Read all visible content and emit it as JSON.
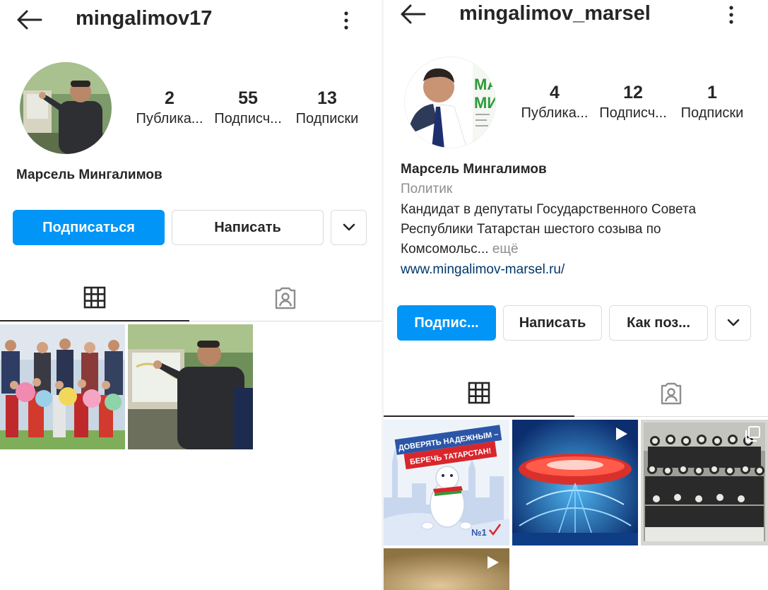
{
  "left": {
    "username": "mingalimov17",
    "stats": [
      {
        "num": "2",
        "label": "Публика..."
      },
      {
        "num": "55",
        "label": "Подписч..."
      },
      {
        "num": "13",
        "label": "Подписки"
      }
    ],
    "full_name": "Марсель Мингалимов",
    "buttons": {
      "follow": "Подписаться",
      "message": "Написать"
    }
  },
  "right": {
    "username": "mingalimov_marsel",
    "stats": [
      {
        "num": "4",
        "label": "Публика..."
      },
      {
        "num": "12",
        "label": "Подписч..."
      },
      {
        "num": "1",
        "label": "Подписки"
      }
    ],
    "full_name": "Марсель Мингалимов",
    "category": "Политик",
    "bio_lines": [
      "Кандидат в депутаты Государственного Совета",
      "Республики Татарстан шестого созыва по",
      "Комсомольс..."
    ],
    "bio_more": "ещё",
    "website": "www.mingalimov-marsel.ru/",
    "buttons": {
      "follow": "Подпис...",
      "message": "Написать",
      "contact": "Как поз..."
    },
    "avatar_logo_text": [
      "МА",
      "МИ"
    ],
    "post_texts": {
      "banner_line1": "ДОВЕРЯТЬ НАДЕЖНЫМ –",
      "banner_line2": "БЕРЕЧЬ ТАТАРСТАН!",
      "badge": "№1"
    }
  },
  "colors": {
    "accent": "#0095f6",
    "text": "#262626",
    "muted": "#8e8e8e",
    "link": "#00376b",
    "border": "#dbdbdb"
  },
  "icons": [
    "back-arrow-icon",
    "more-vertical-icon",
    "chevron-down-icon",
    "grid-icon",
    "tagged-icon",
    "video-icon",
    "carousel-icon"
  ]
}
